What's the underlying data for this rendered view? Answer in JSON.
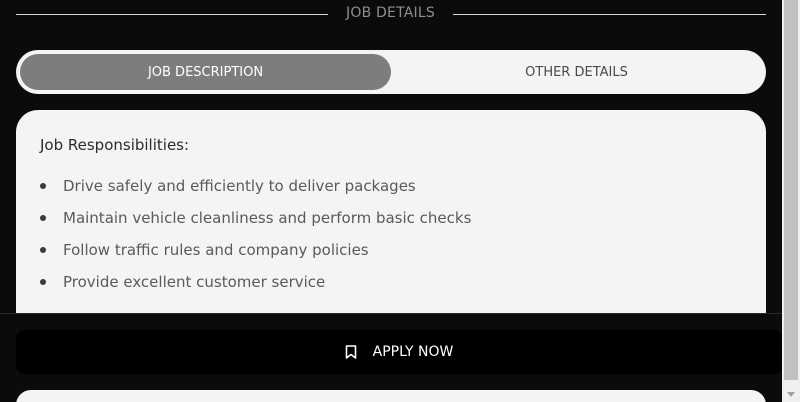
{
  "section": {
    "title": "JOB DETAILS"
  },
  "tabs": [
    {
      "label": "JOB DESCRIPTION",
      "active": true
    },
    {
      "label": "OTHER DETAILS",
      "active": false
    }
  ],
  "card": {
    "heading": "Job Responsibilities:",
    "items": [
      "Drive safely and efficiently to deliver packages",
      "Maintain vehicle cleanliness and perform basic checks",
      "Follow traffic rules and company policies",
      "Provide excellent customer service"
    ]
  },
  "apply": {
    "label": "APPLY NOW",
    "icon": "bookmark-icon"
  },
  "colors": {
    "background": "#0b0b0c",
    "card": "#f4f4f4",
    "active_tab": "#7d7d7d",
    "button": "#000000"
  }
}
